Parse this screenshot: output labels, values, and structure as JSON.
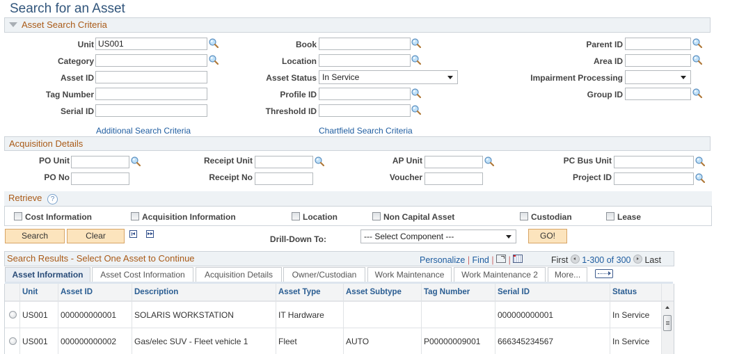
{
  "page": {
    "title": "Search for an Asset"
  },
  "criteria": {
    "header": "Asset Search Criteria",
    "fields": {
      "unit": {
        "label": "Unit",
        "value": "US001"
      },
      "category": {
        "label": "Category",
        "value": ""
      },
      "asset_id": {
        "label": "Asset ID",
        "value": ""
      },
      "tag_number": {
        "label": "Tag Number",
        "value": ""
      },
      "serial_id": {
        "label": "Serial ID",
        "value": ""
      },
      "book": {
        "label": "Book",
        "value": ""
      },
      "location": {
        "label": "Location",
        "value": ""
      },
      "asset_status": {
        "label": "Asset Status",
        "value": "In Service"
      },
      "profile_id": {
        "label": "Profile ID",
        "value": ""
      },
      "threshold_id": {
        "label": "Threshold ID",
        "value": ""
      },
      "parent_id": {
        "label": "Parent ID",
        "value": ""
      },
      "area_id": {
        "label": "Area ID",
        "value": ""
      },
      "impairment": {
        "label": "Impairment Processing",
        "value": ""
      },
      "group_id": {
        "label": "Group ID",
        "value": ""
      }
    },
    "links": {
      "additional": "Additional Search Criteria",
      "chartfield": "Chartfield Search Criteria"
    }
  },
  "acquisition": {
    "header": "Acquisition Details",
    "fields": {
      "po_unit": {
        "label": "PO Unit",
        "value": ""
      },
      "po_no": {
        "label": "PO No",
        "value": ""
      },
      "receipt_unit": {
        "label": "Receipt Unit",
        "value": ""
      },
      "receipt_no": {
        "label": "Receipt No",
        "value": ""
      },
      "ap_unit": {
        "label": "AP Unit",
        "value": ""
      },
      "voucher": {
        "label": "Voucher",
        "value": ""
      },
      "pc_bus_unit": {
        "label": "PC Bus Unit",
        "value": ""
      },
      "project_id": {
        "label": "Project ID",
        "value": ""
      }
    }
  },
  "retrieve": {
    "header": "Retrieve",
    "options": [
      "Cost Information",
      "Acquisition Information",
      "Location",
      "Non Capital Asset",
      "Custodian",
      "Lease"
    ]
  },
  "actions": {
    "search": "Search",
    "clear": "Clear",
    "drilldown_label": "Drill-Down To:",
    "drilldown_value": "--- Select Component ---",
    "go": "GO!"
  },
  "results": {
    "header": "Search Results - Select One Asset to Continue",
    "personalize": "Personalize",
    "find": "Find",
    "first": "First",
    "range": "1-300 of 300",
    "last": "Last",
    "tabs": [
      "Asset Information",
      "Asset Cost Information",
      "Acquisition Details",
      "Owner/Custodian",
      "Work Maintenance",
      "Work Maintenance 2",
      "More..."
    ],
    "columns": [
      "Unit",
      "Asset ID",
      "Description",
      "Asset Type",
      "Asset Subtype",
      "Tag Number",
      "Serial ID",
      "Status"
    ],
    "rows": [
      [
        "US001",
        "000000000001",
        "SOLARIS WORKSTATION",
        "IT Hardware",
        "",
        "",
        "000000000001",
        "In Service"
      ],
      [
        "US001",
        "000000000002",
        "Gas/elec SUV - Fleet vehicle 1",
        "Fleet",
        "AUTO",
        "P00000009001",
        "666345234567",
        "In Service"
      ]
    ]
  }
}
